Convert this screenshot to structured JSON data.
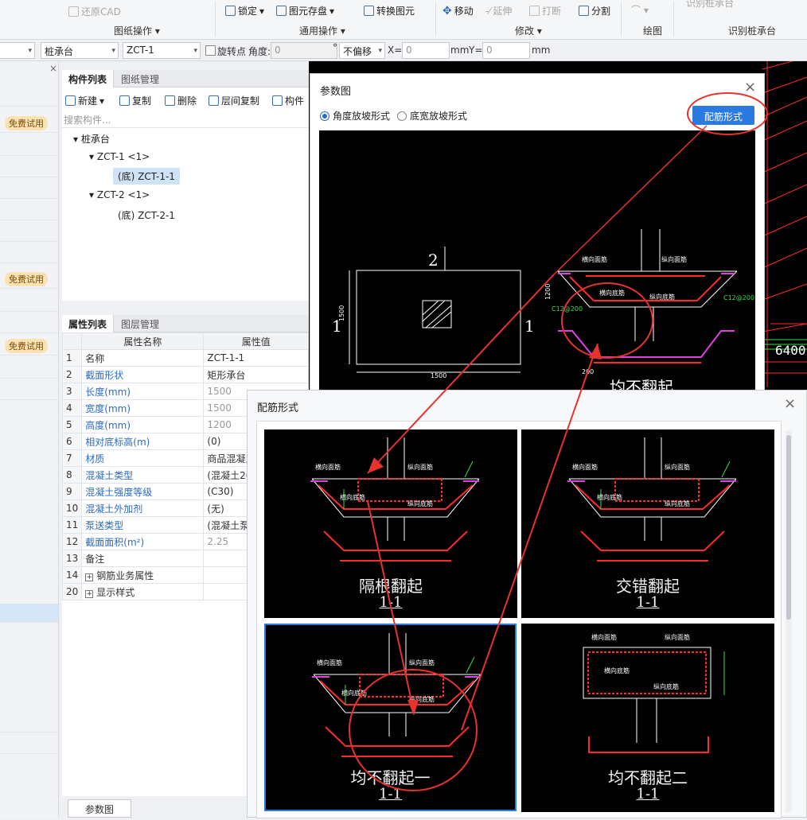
{
  "ribbon": {
    "restore_cad": "还原CAD",
    "lock": "锁定",
    "element_save": "图元存盘",
    "convert_element": "转换图元",
    "move": "移动",
    "extend": "延伸",
    "break": "打断",
    "split": "分割",
    "groups": {
      "drawing_ops": "图纸操作",
      "general_ops": "通用操作",
      "modify": "修改",
      "draw": "绘图",
      "recognize_cap": "识别桩承台"
    },
    "recognize_top_partial": "识别桩承台"
  },
  "toolbar": {
    "type_select": "桩承台",
    "component_select": "ZCT-1",
    "rotate_point": "旋转点",
    "angle_label": "角度:",
    "angle_value": "0",
    "degree": "°",
    "offset_select": "不偏移",
    "x_label": "X=",
    "x_value": "0",
    "mm1": "mm",
    "y_label": "Y=",
    "y_value": "0",
    "mm2": "mm"
  },
  "left_strip": {
    "badges": [
      "免费试用",
      "免费试用",
      "免费试用"
    ]
  },
  "component_panel": {
    "tabs": [
      "构件列表",
      "图纸管理"
    ],
    "tools": [
      "新建",
      "复制",
      "删除",
      "层间复制",
      "构件"
    ],
    "search_placeholder": "搜索构件...",
    "tree": {
      "root": "桩承台",
      "zct1": "ZCT-1 <1>",
      "zct1_1": "(底)  ZCT-1-1",
      "zct2": "ZCT-2 <1>",
      "zct2_1": "(底)  ZCT-2-1"
    }
  },
  "property_panel": {
    "tabs": [
      "属性列表",
      "图层管理"
    ],
    "col_name": "属性名称",
    "col_value": "属性值",
    "rows": [
      {
        "idx": "1",
        "name": "名称",
        "value": "ZCT-1-1"
      },
      {
        "idx": "2",
        "name": "截面形状",
        "value": "矩形承台"
      },
      {
        "idx": "3",
        "name": "长度(mm)",
        "value": "1500"
      },
      {
        "idx": "4",
        "name": "宽度(mm)",
        "value": "1500"
      },
      {
        "idx": "5",
        "name": "高度(mm)",
        "value": "1200"
      },
      {
        "idx": "6",
        "name": "相对底标高(m)",
        "value": "(0)"
      },
      {
        "idx": "7",
        "name": "材质",
        "value": "商品混凝土"
      },
      {
        "idx": "8",
        "name": "混凝土类型",
        "value": "(混凝土20石)"
      },
      {
        "idx": "9",
        "name": "混凝土强度等级",
        "value": "(C30)"
      },
      {
        "idx": "10",
        "name": "混凝土外加剂",
        "value": "(无)"
      },
      {
        "idx": "11",
        "name": "泵送类型",
        "value": "(混凝土泵)"
      },
      {
        "idx": "12",
        "name": "截面面积(m²)",
        "value": "2.25"
      },
      {
        "idx": "13",
        "name": "备注",
        "value": ""
      },
      {
        "idx": "14",
        "name": "钢筋业务属性",
        "value": ""
      },
      {
        "idx": "20",
        "name": "显示样式",
        "value": ""
      }
    ]
  },
  "bottom_tab": "参数图",
  "cad_right_label": "6400",
  "dialog_params": {
    "title": "参数图",
    "radio_angle": "角度放坡形式",
    "radio_width": "底宽放坡形式",
    "rebar_button": "配筋形式",
    "plan": {
      "label_top": "2",
      "label_left": "1",
      "label_right": "1",
      "dim_h": "1500",
      "dim_v": "1500"
    },
    "section": {
      "top_h": "横向面筋",
      "top_v": "纵向面筋",
      "bot_h": "横向底筋",
      "bot_v": "纵向底筋",
      "side": "C12@200",
      "dim": "200",
      "h": "1200"
    },
    "caption_partial": "均不翻起"
  },
  "dialog_rebar": {
    "title": "配筋形式",
    "options": [
      {
        "title": "隔根翻起",
        "section": "1-1"
      },
      {
        "title": "交错翻起",
        "section": "1-1"
      },
      {
        "title": "均不翻起一",
        "section": "1-1"
      },
      {
        "title": "均不翻起二",
        "section": "1-1"
      }
    ],
    "labels": {
      "h_top": "横向面筋",
      "v_top": "纵向面筋",
      "h_bot": "横向底筋",
      "v_bot": "纵向底筋"
    }
  },
  "colors": {
    "accent": "#2a7ae0",
    "annotation": "#e8322d",
    "cad_red": "#ff2a2a",
    "cad_green": "#39e04a",
    "cad_magenta": "#e040e0",
    "cad_yellow": "#f0e040"
  }
}
